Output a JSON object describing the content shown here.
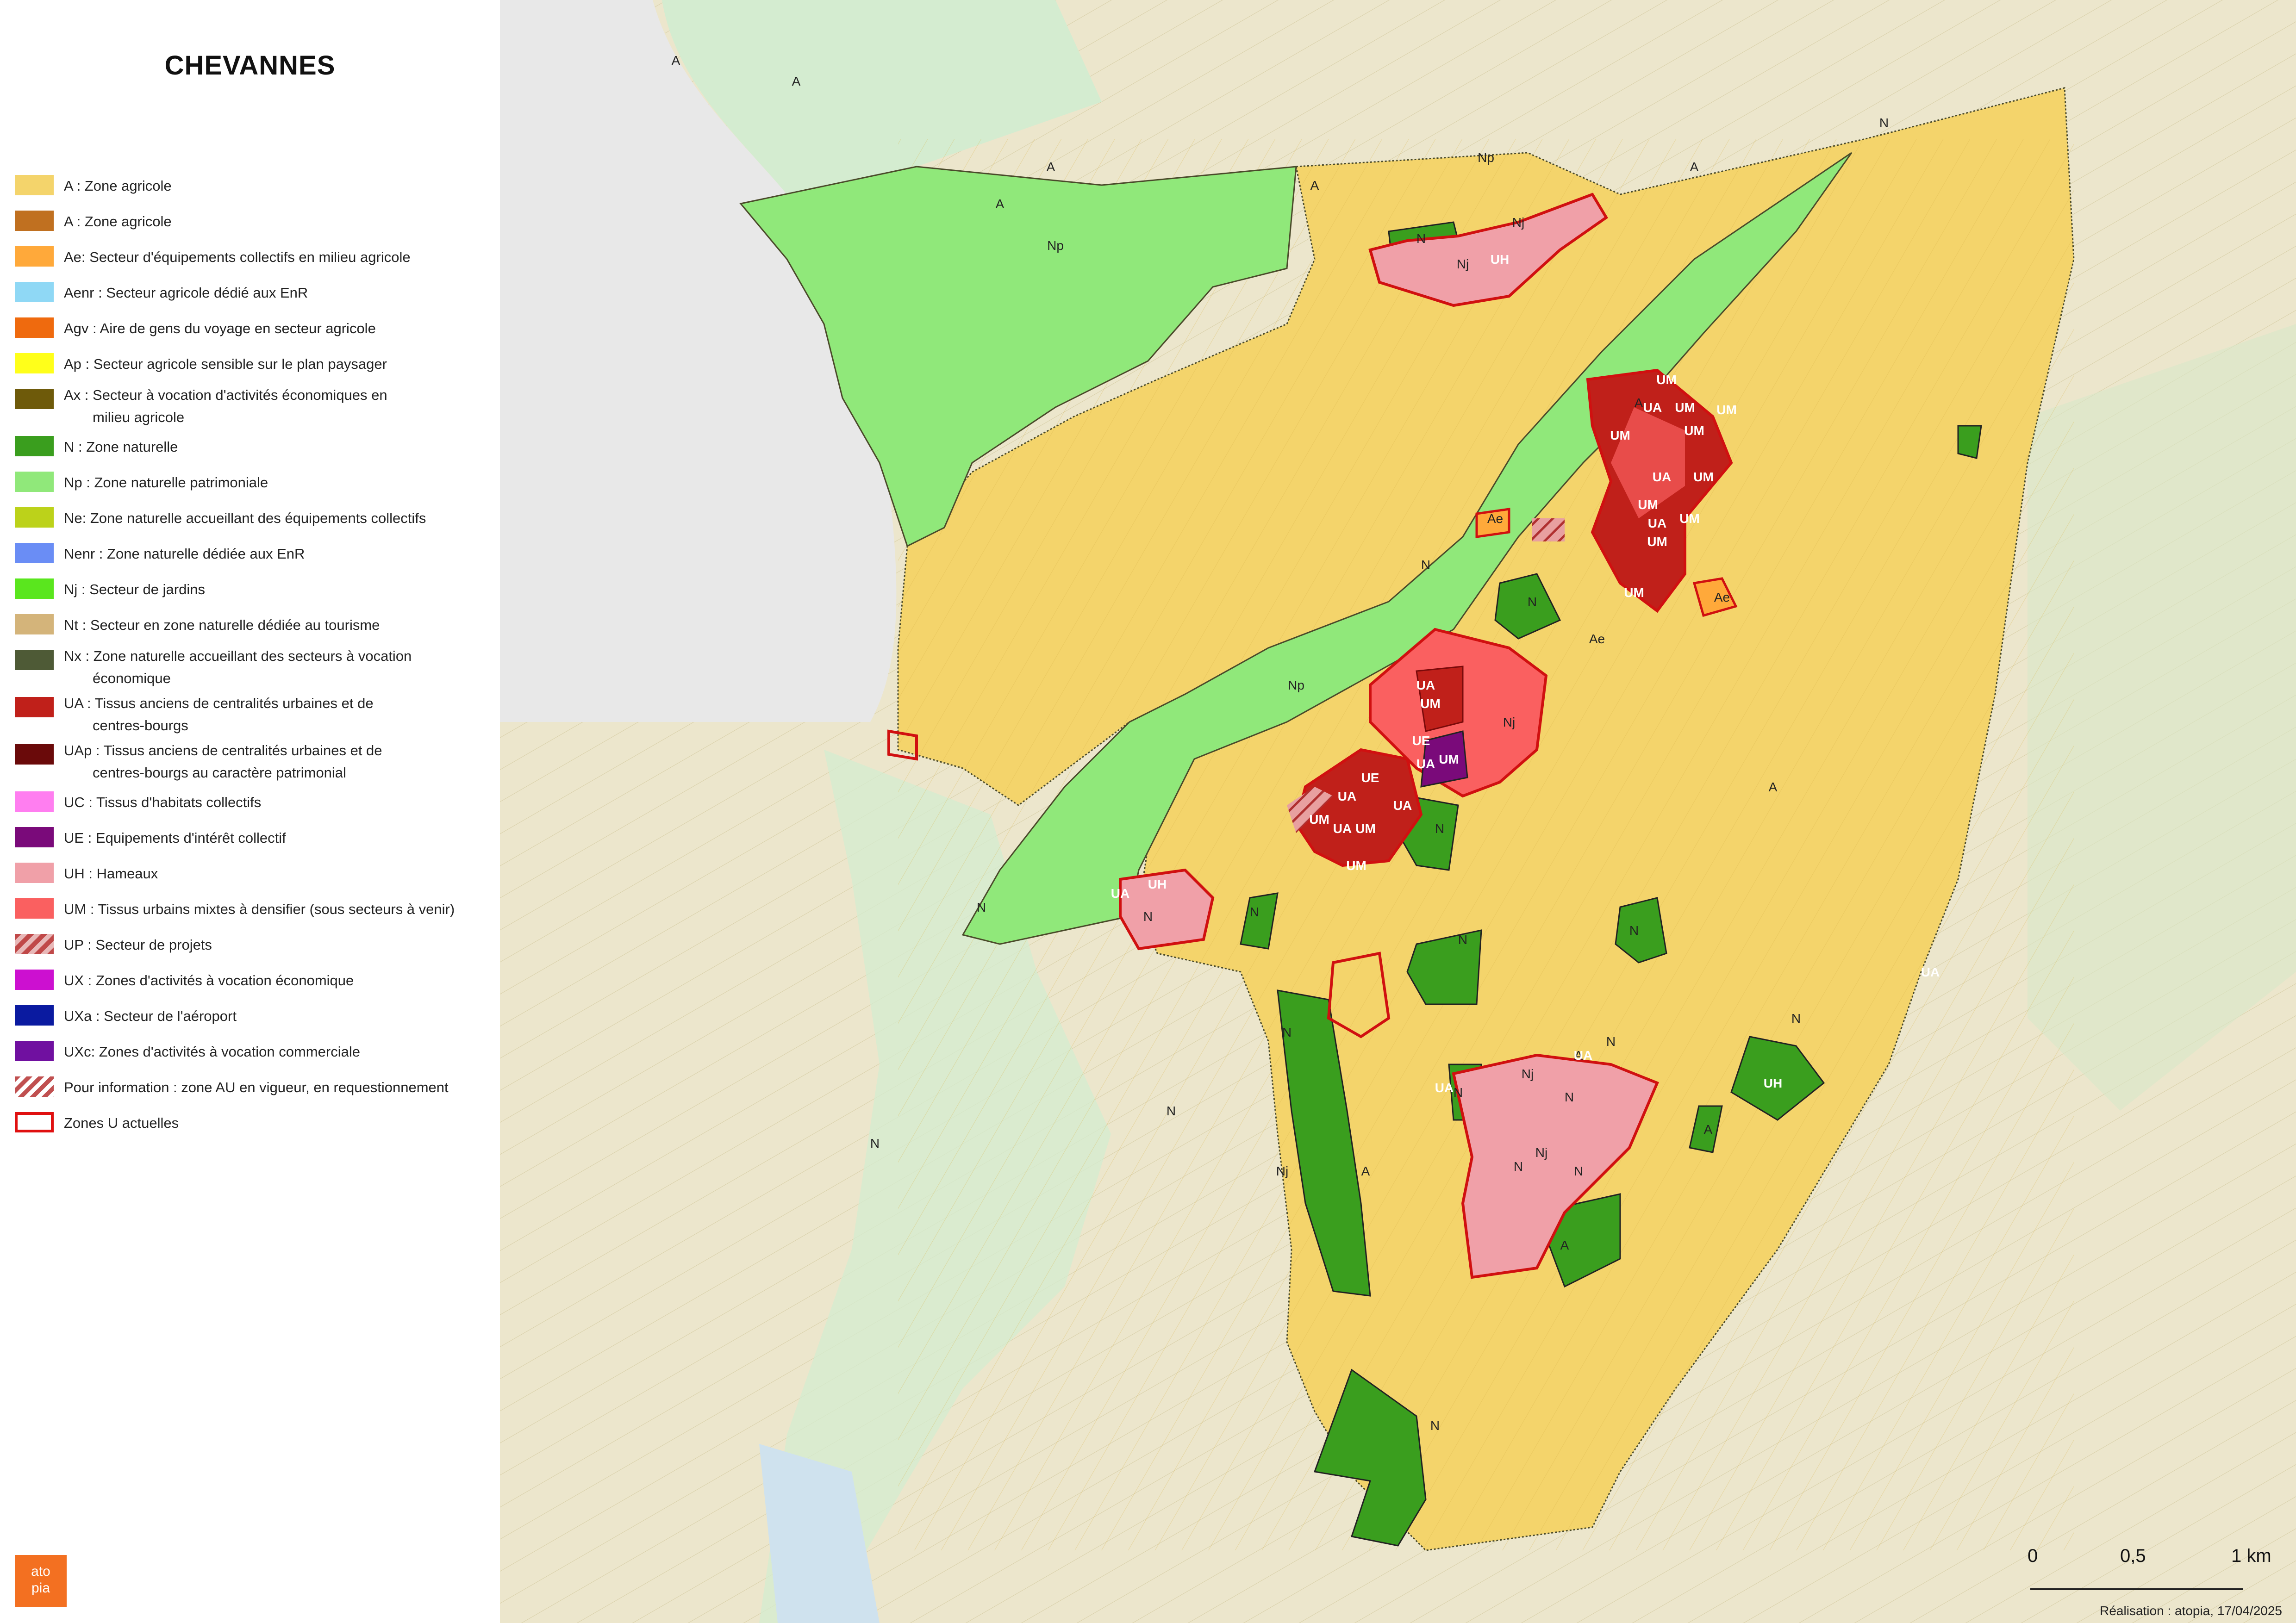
{
  "title": "CHEVANNES",
  "legend": [
    {
      "label": "A : Zone agricole",
      "color": "#f4d46b",
      "style": "fill"
    },
    {
      "label": "A : Zone agricole",
      "color": "#c07020",
      "style": "fill"
    },
    {
      "label": "Ae: Secteur d'équipements collectifs en milieu agricole",
      "color": "#ffa93a",
      "style": "fill"
    },
    {
      "label": "Aenr : Secteur agricole dédié aux EnR",
      "color": "#8fd8f5",
      "style": "fill"
    },
    {
      "label": "Agv : Aire de gens du voyage en secteur agricole",
      "color": "#ef6a0e",
      "style": "fill"
    },
    {
      "label": "Ap : Secteur agricole sensible sur le plan paysager",
      "color": "#ffff1a",
      "style": "fill"
    },
    {
      "label": "Ax : Secteur à vocation d'activités économiques en",
      "label2": "milieu agricole",
      "color": "#6e5a0a",
      "style": "fill"
    },
    {
      "label": "N : Zone naturelle",
      "color": "#3a9e1e",
      "style": "fill"
    },
    {
      "label": "Np : Zone naturelle patrimoniale",
      "color": "#90e87a",
      "style": "fill"
    },
    {
      "label": "Ne: Zone naturelle accueillant des équipements collectifs",
      "color": "#bcd21a",
      "style": "fill"
    },
    {
      "label": "Nenr : Zone naturelle dédiée aux EnR",
      "color": "#6a8df5",
      "style": "fill"
    },
    {
      "label": "Nj : Secteur de jardins",
      "color": "#5ae61e",
      "style": "fill"
    },
    {
      "label": "Nt : Secteur en zone naturelle dédiée au tourisme",
      "color": "#d4b47a",
      "style": "fill"
    },
    {
      "label": "Nx : Zone naturelle accueillant des secteurs à vocation",
      "label2": "économique",
      "color": "#4e5a36",
      "style": "fill"
    },
    {
      "label": "UA : Tissus anciens de centralités urbaines et de",
      "label2": "centres-bourgs",
      "color": "#c0201a",
      "style": "fill"
    },
    {
      "label": "UAp : Tissus anciens de centralités urbaines et de",
      "label2": "centres-bourgs au caractère patrimonial",
      "color": "#6a0a0a",
      "style": "fill"
    },
    {
      "label": "UC : Tissus d'habitats collectifs",
      "color": "#ff7ef0",
      "style": "fill"
    },
    {
      "label": "UE : Equipements d'intérêt collectif",
      "color": "#7a0a7a",
      "style": "fill"
    },
    {
      "label": "UH : Hameaux",
      "color": "#f0a0a8",
      "style": "fill"
    },
    {
      "label": "UM : Tissus urbains mixtes à densifier (sous secteurs à venir)",
      "color": "#fa6060",
      "style": "fill"
    },
    {
      "label": "UP : Secteur de projets",
      "color": "#c04848",
      "style": "hatch"
    },
    {
      "label": "UX : Zones d'activités à vocation économique",
      "color": "#cc10d0",
      "style": "fill"
    },
    {
      "label": "UXa : Secteur de l'aéroport",
      "color": "#0a1aa0",
      "style": "fill"
    },
    {
      "label": "UXc: Zones d'activités à vocation commerciale",
      "color": "#7010a0",
      "style": "fill"
    },
    {
      "label": "Pour information : zone AU en vigueur, en requestionnement",
      "color": "#c05050",
      "style": "hatch-light"
    },
    {
      "label": "Zones U actuelles",
      "color": "#e01010",
      "style": "outline"
    }
  ],
  "map_labels": [
    {
      "text": "A",
      "kind": "outside"
    },
    {
      "text": "A",
      "kind": "outside"
    },
    {
      "text": "A",
      "kind": "outside"
    },
    {
      "text": "Np",
      "kind": "outside"
    },
    {
      "text": "A",
      "kind": "outside"
    },
    {
      "text": "A",
      "kind": "outside"
    },
    {
      "text": "N",
      "kind": "outside"
    },
    {
      "text": "Np",
      "kind": "inside"
    },
    {
      "text": "A",
      "kind": "inside"
    },
    {
      "text": "N",
      "kind": "inside"
    },
    {
      "text": "Nj",
      "kind": "inside"
    },
    {
      "text": "Nj",
      "kind": "inside"
    },
    {
      "text": "UH",
      "kind": "inside"
    },
    {
      "text": "N",
      "kind": "inside"
    },
    {
      "text": "A",
      "kind": "inside"
    },
    {
      "text": "UM",
      "kind": "inside"
    },
    {
      "text": "UA",
      "kind": "inside"
    },
    {
      "text": "UM",
      "kind": "inside"
    },
    {
      "text": "UM",
      "kind": "inside"
    },
    {
      "text": "UM",
      "kind": "inside"
    },
    {
      "text": "UM",
      "kind": "inside"
    },
    {
      "text": "UA",
      "kind": "inside"
    },
    {
      "text": "UM",
      "kind": "inside"
    },
    {
      "text": "UM",
      "kind": "inside"
    },
    {
      "text": "UA",
      "kind": "inside"
    },
    {
      "text": "UM",
      "kind": "inside"
    },
    {
      "text": "UM",
      "kind": "inside"
    },
    {
      "text": "UM",
      "kind": "inside"
    },
    {
      "text": "Ae",
      "kind": "inside"
    },
    {
      "text": "Ae",
      "kind": "inside"
    },
    {
      "text": "N",
      "kind": "inside"
    },
    {
      "text": "Ae",
      "kind": "inside"
    },
    {
      "text": "N",
      "kind": "inside"
    },
    {
      "text": "A",
      "kind": "inside"
    },
    {
      "text": "Np",
      "kind": "inside"
    },
    {
      "text": "UA",
      "kind": "inside"
    },
    {
      "text": "UM",
      "kind": "inside"
    },
    {
      "text": "Nj",
      "kind": "inside"
    },
    {
      "text": "UE",
      "kind": "inside"
    },
    {
      "text": "UA",
      "kind": "inside"
    },
    {
      "text": "UM",
      "kind": "inside"
    },
    {
      "text": "UE",
      "kind": "inside"
    },
    {
      "text": "UA",
      "kind": "inside"
    },
    {
      "text": "UA",
      "kind": "inside"
    },
    {
      "text": "UM",
      "kind": "inside"
    },
    {
      "text": "UA",
      "kind": "inside"
    },
    {
      "text": "UM",
      "kind": "inside"
    },
    {
      "text": "UM",
      "kind": "inside"
    },
    {
      "text": "N",
      "kind": "inside"
    },
    {
      "text": "A",
      "kind": "inside"
    },
    {
      "text": "UA",
      "kind": "inside"
    },
    {
      "text": "UA",
      "kind": "inside"
    },
    {
      "text": "UH",
      "kind": "inside"
    },
    {
      "text": "N",
      "kind": "inside"
    },
    {
      "text": "N",
      "kind": "inside"
    },
    {
      "text": "N",
      "kind": "inside"
    },
    {
      "text": "N",
      "kind": "inside"
    },
    {
      "text": "N",
      "kind": "outside"
    },
    {
      "text": "N",
      "kind": "outside"
    },
    {
      "text": "UA",
      "kind": "inside"
    },
    {
      "text": "N",
      "kind": "inside"
    },
    {
      "text": "Nj",
      "kind": "inside"
    },
    {
      "text": "Nj",
      "kind": "inside"
    },
    {
      "text": "N",
      "kind": "inside"
    },
    {
      "text": "UA",
      "kind": "inside"
    },
    {
      "text": "N",
      "kind": "inside"
    },
    {
      "text": "N",
      "kind": "inside"
    },
    {
      "text": "UH",
      "kind": "inside"
    },
    {
      "text": "A",
      "kind": "inside"
    },
    {
      "text": "Nj",
      "kind": "inside"
    },
    {
      "text": "N",
      "kind": "inside"
    },
    {
      "text": "N",
      "kind": "inside"
    },
    {
      "text": "A",
      "kind": "outside"
    },
    {
      "text": "A",
      "kind": "inside"
    },
    {
      "text": "N",
      "kind": "inside"
    },
    {
      "text": "N",
      "kind": "outside"
    }
  ],
  "scale_bar": {
    "ticks": [
      "0",
      "0,5",
      "1 km"
    ]
  },
  "credit": "Réalisation : atopia, 17/04/2025",
  "logo": {
    "line1": "ato",
    "line2": "pia"
  }
}
